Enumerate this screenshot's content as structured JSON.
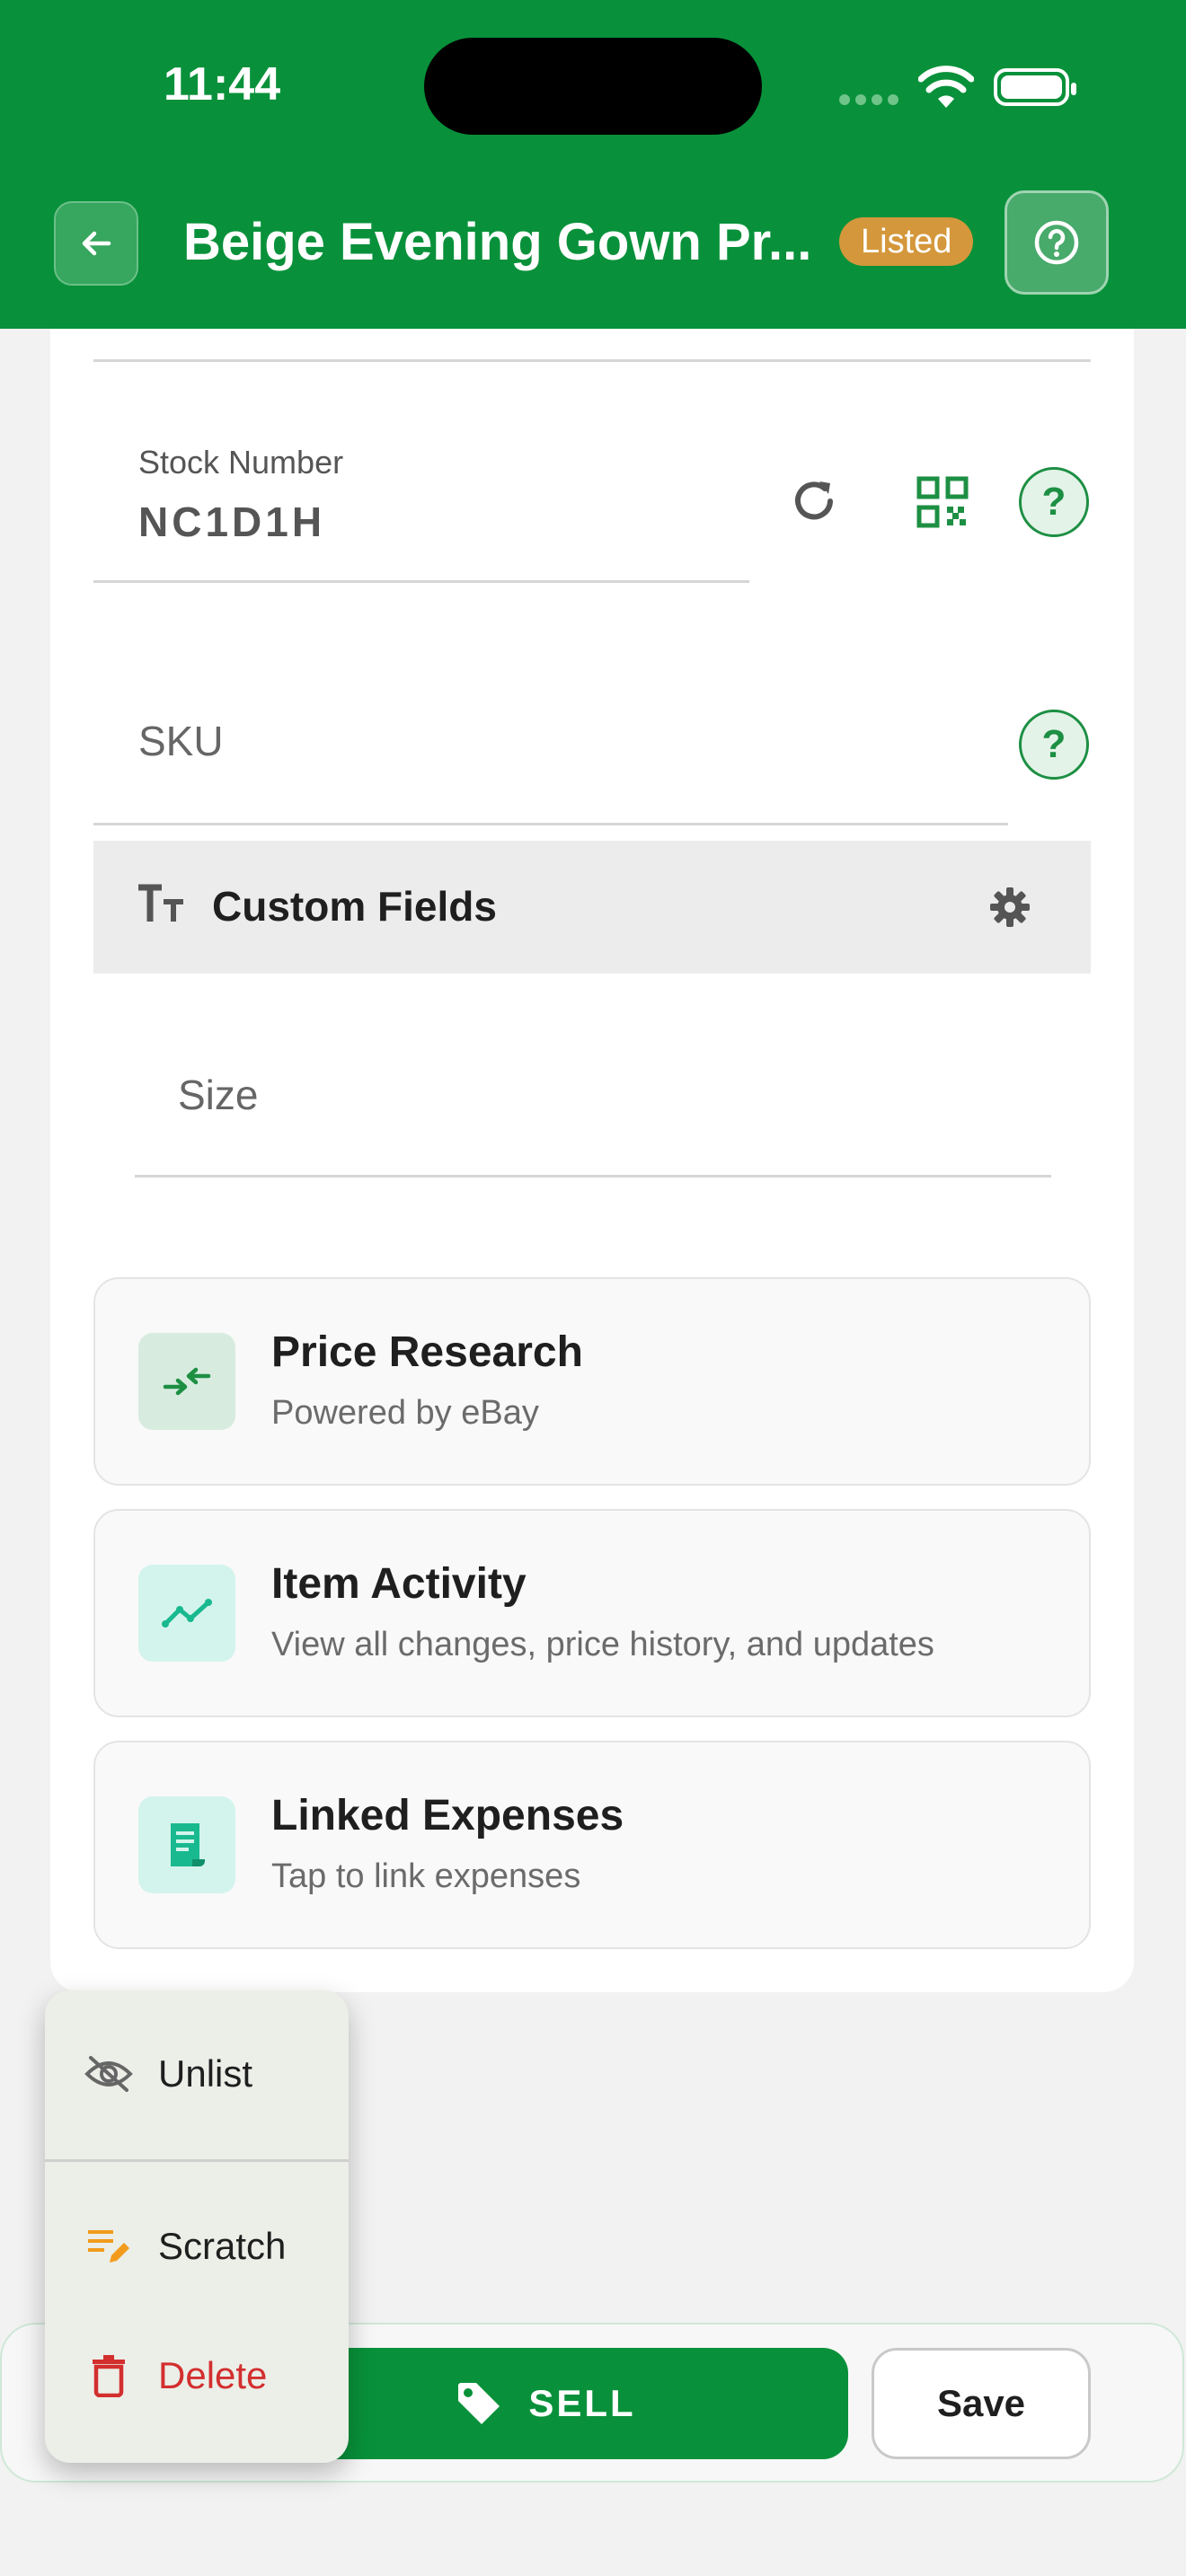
{
  "status_bar": {
    "time": "11:44"
  },
  "header": {
    "title": "Beige Evening Gown Pr...",
    "badge": "Listed"
  },
  "fields": {
    "stock_number": {
      "label": "Stock Number",
      "value": "NC1D1H"
    },
    "sku": {
      "placeholder": "SKU"
    }
  },
  "custom_fields": {
    "title": "Custom Fields",
    "size_placeholder": "Size"
  },
  "features": [
    {
      "title": "Price Research",
      "subtitle": "Powered by eBay"
    },
    {
      "title": "Item Activity",
      "subtitle": "View all changes, price history, and updates"
    },
    {
      "title": "Linked Expenses",
      "subtitle": "Tap to link expenses"
    }
  ],
  "menu": {
    "unlist": "Unlist",
    "scratch": "Scratch",
    "delete": "Delete"
  },
  "actions": {
    "sell": "SELL",
    "save": "Save"
  },
  "colors": {
    "brand_green": "#08913a",
    "listed_badge": "#d4973b",
    "delete_red": "#d32f2f",
    "scratch_orange": "#f29b1d"
  }
}
